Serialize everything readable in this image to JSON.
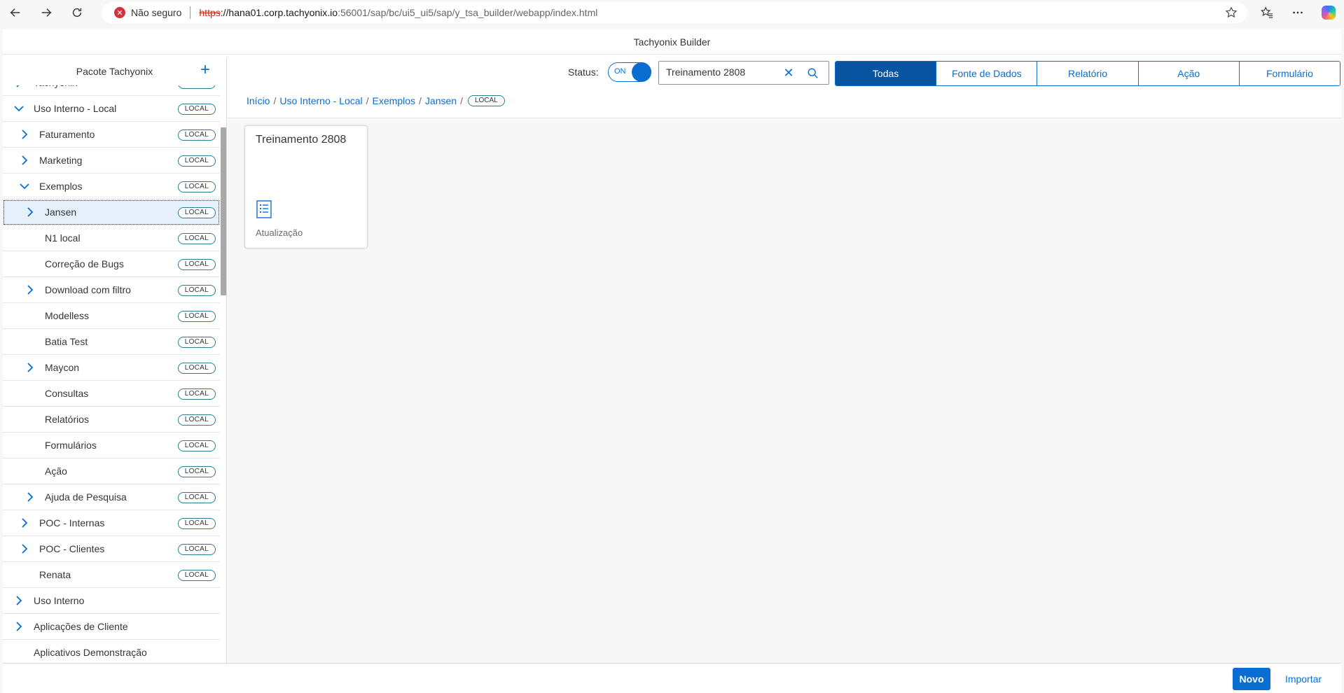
{
  "browser": {
    "security_label": "Não seguro",
    "url_proto": "https",
    "url_host": "://hana01.corp.tachyonix.io",
    "url_path": ":56001/sap/bc/ui5_ui5/sap/y_tsa_builder/webapp/index.html"
  },
  "app": {
    "title": "Tachyonix Builder"
  },
  "sidebar": {
    "header": "Pacote Tachyonix",
    "badge": "LOCAL",
    "items": [
      {
        "label": "Tachyonix",
        "level": 0,
        "chevron": "right",
        "badge": true
      },
      {
        "label": "Uso Interno - Local",
        "level": 0,
        "chevron": "down",
        "badge": true
      },
      {
        "label": "Faturamento",
        "level": 1,
        "chevron": "right",
        "badge": true
      },
      {
        "label": "Marketing",
        "level": 1,
        "chevron": "right",
        "badge": true
      },
      {
        "label": "Exemplos",
        "level": 1,
        "chevron": "down",
        "badge": true
      },
      {
        "label": "Jansen",
        "level": 2,
        "chevron": "right",
        "badge": true,
        "selected": true
      },
      {
        "label": "N1 local",
        "level": 2,
        "chevron": "",
        "badge": true
      },
      {
        "label": "Correção de Bugs",
        "level": 2,
        "chevron": "",
        "badge": true
      },
      {
        "label": "Download com filtro",
        "level": 2,
        "chevron": "right",
        "badge": true
      },
      {
        "label": "Modelless",
        "level": 2,
        "chevron": "",
        "badge": true
      },
      {
        "label": "Batia Test",
        "level": 2,
        "chevron": "",
        "badge": true
      },
      {
        "label": "Maycon",
        "level": 2,
        "chevron": "right",
        "badge": true
      },
      {
        "label": "Consultas",
        "level": 2,
        "chevron": "",
        "badge": true
      },
      {
        "label": "Relatórios",
        "level": 2,
        "chevron": "",
        "badge": true
      },
      {
        "label": "Formulários",
        "level": 2,
        "chevron": "",
        "badge": true
      },
      {
        "label": "Ação",
        "level": 2,
        "chevron": "",
        "badge": true
      },
      {
        "label": "Ajuda de Pesquisa",
        "level": 2,
        "chevron": "right",
        "badge": true
      },
      {
        "label": "POC - Internas",
        "level": 1,
        "chevron": "right",
        "badge": true
      },
      {
        "label": "POC - Clientes",
        "level": 1,
        "chevron": "right",
        "badge": true
      },
      {
        "label": "Renata",
        "level": 1,
        "chevron": "",
        "badge": true
      },
      {
        "label": "Uso Interno",
        "level": 0,
        "chevron": "right",
        "badge": false
      },
      {
        "label": "Aplicações de Cliente",
        "level": 0,
        "chevron": "right",
        "badge": false
      },
      {
        "label": "Aplicativos Demonstração",
        "level": 0,
        "chevron": "",
        "badge": false
      }
    ]
  },
  "toolbar": {
    "status_label": "Status:",
    "toggle_text": "ON",
    "search_value": "Treinamento 2808",
    "filters": [
      {
        "label": "Todas",
        "active": true
      },
      {
        "label": "Fonte de Dados",
        "active": false
      },
      {
        "label": "Relatório",
        "active": false
      },
      {
        "label": "Ação",
        "active": false
      },
      {
        "label": "Formulário",
        "active": false
      }
    ]
  },
  "breadcrumb": {
    "items": [
      "Início",
      "Uso Interno - Local",
      "Exemplos",
      "Jansen"
    ],
    "badge": "LOCAL"
  },
  "tile": {
    "title": "Treinamento 2808",
    "icon": "form-list-icon",
    "subtitle": "Atualização"
  },
  "footer": {
    "new_label": "Novo",
    "import_label": "Importar"
  },
  "colors": {
    "accent": "#0a6ed1",
    "active_segment": "#0854a0",
    "selected_row": "#e5f0fa",
    "badge_border": "#2d7d8c"
  }
}
